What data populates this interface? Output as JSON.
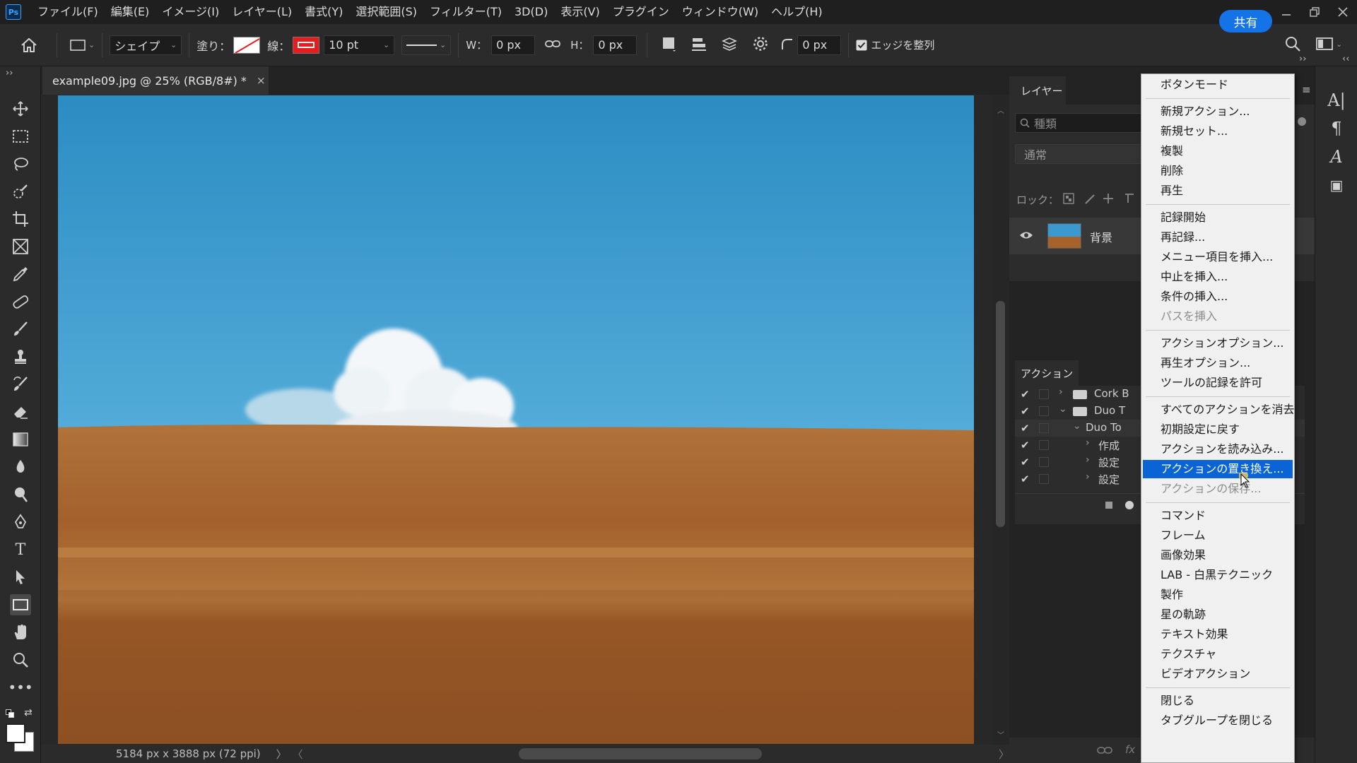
{
  "app": {
    "logo": "Ps"
  },
  "menubar": {
    "items": [
      "ファイル(F)",
      "編集(E)",
      "イメージ(I)",
      "レイヤー(L)",
      "書式(Y)",
      "選択範囲(S)",
      "フィルター(T)",
      "3D(D)",
      "表示(V)",
      "プラグイン",
      "ウィンドウ(W)",
      "ヘルプ(H)"
    ]
  },
  "options": {
    "mode": "シェイプ",
    "fill_label": "塗り：",
    "stroke_label": "線：",
    "stroke_color": "#e81c1c",
    "stroke_width": "10 pt",
    "w_label": "W：",
    "w_value": "0 px",
    "h_label": "H：",
    "h_value": "0 px",
    "radius_value": "0 px",
    "align_edges_label": "エッジを整列",
    "share_label": "共有"
  },
  "document": {
    "tab_title": "example09.jpg @ 25% (RGB/8#) *",
    "close_icon": "×",
    "status": "5184 px x 3888 px (72 ppi)",
    "status_arrow": "〉",
    "scroll_left": "〈",
    "scroll_right": "〉"
  },
  "layers_panel": {
    "tab": "レイヤー",
    "search_placeholder": "種類",
    "blend_mode": "通常",
    "lock_label": "ロック：",
    "layer_name": "背景",
    "footer_fx": "fx"
  },
  "actions_panel": {
    "tab": "アクション",
    "rows": [
      {
        "label": "Cork B"
      },
      {
        "label": "Duo T"
      },
      {
        "label": "Duo To"
      },
      {
        "label": "作成"
      },
      {
        "label": "設定"
      },
      {
        "label": "設定"
      }
    ]
  },
  "context_menu": {
    "button_mode": "ボタンモード",
    "group1": [
      "新規アクション...",
      "新規セット...",
      "複製",
      "削除",
      "再生"
    ],
    "group2": [
      "記録開始",
      "再記録...",
      "メニュー項目を挿入...",
      "中止を挿入...",
      "条件の挿入..."
    ],
    "group2_disabled": "パスを挿入",
    "group3": [
      "アクションオプション...",
      "再生オプション...",
      "ツールの記録を許可"
    ],
    "group4a": [
      "すべてのアクションを消去",
      "初期設定に戻す",
      "アクションを読み込み..."
    ],
    "group4_selected": "アクションの置き換え...",
    "group4_disabled": "アクションの保存...",
    "group5": [
      "コマンド",
      "フレーム",
      "画像効果",
      "LAB - 白黒テクニック",
      "製作",
      "星の軌跡",
      "テキスト効果",
      "テクスチャ",
      "ビデオアクション"
    ],
    "group6": [
      "閉じる",
      "タブグループを閉じる"
    ]
  },
  "right_strip": {
    "icons": [
      "A|",
      "¶",
      "A",
      "▣"
    ]
  },
  "colors": {
    "accent": "#1473e6",
    "selection": "#0a64d6",
    "sky_top": "#2d8fc4",
    "sky_bottom": "#4ca9d8",
    "field": "#a5622a"
  }
}
